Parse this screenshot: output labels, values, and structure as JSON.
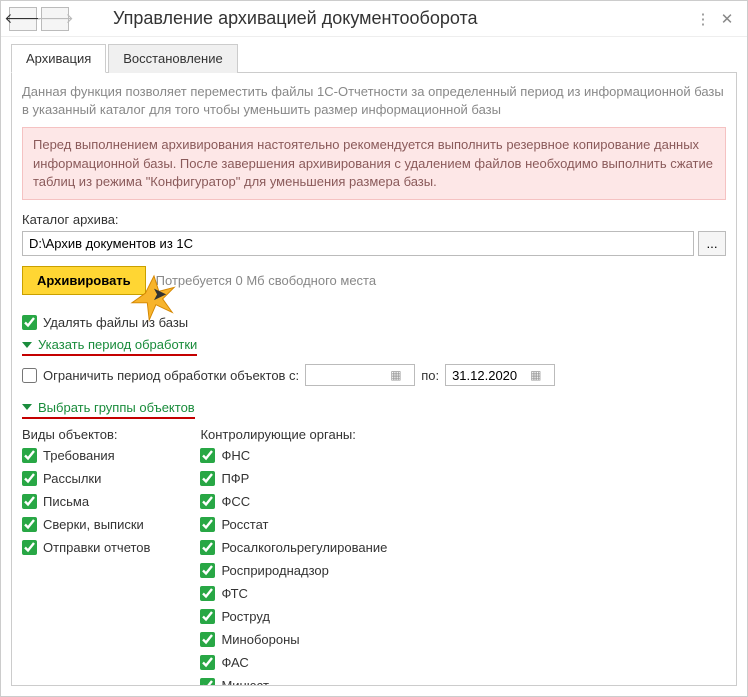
{
  "window": {
    "title": "Управление архивацией документооборота"
  },
  "tabs": {
    "archive": "Архивация",
    "restore": "Восстановление"
  },
  "desc": "Данная функция позволяет переместить файлы 1С-Отчетности за определенный период из информационной базы в указанный каталог для того чтобы уменьшить размер информационной базы",
  "warn": "Перед выполнением архивирования настоятельно рекомендуется выполнить резервное копирование данных информационной базы. После завершения архивирования с удалением файлов необходимо выполнить сжатие таблиц из режима \"Конфигуратор\" для уменьшения размера базы.",
  "path": {
    "label": "Каталог архива:",
    "value": "D:\\Архив документов из 1С",
    "browse": "..."
  },
  "actions": {
    "archive": "Архивировать",
    "space": "Потребуется 0 Мб свободного места"
  },
  "opts": {
    "deleteFiles": "Удалять файлы из базы",
    "periodHeader": "Указать период обработки",
    "limitPeriod": "Ограничить период обработки объектов с:",
    "to": "по:",
    "dateFrom": "",
    "dateTo": "31.12.2020",
    "groupsHeader": "Выбрать группы объектов"
  },
  "cols": {
    "left": {
      "title": "Виды объектов:",
      "items": [
        "Требования",
        "Рассылки",
        "Письма",
        "Сверки, выписки",
        "Отправки отчетов"
      ]
    },
    "right": {
      "title": "Контролирующие органы:",
      "items": [
        "ФНС",
        "ПФР",
        "ФСС",
        "Росстат",
        "Росалкогольрегулирование",
        "Росприроднадзор",
        "ФТС",
        "Роструд",
        "Минобороны",
        "ФАС",
        "Минюст"
      ]
    }
  }
}
